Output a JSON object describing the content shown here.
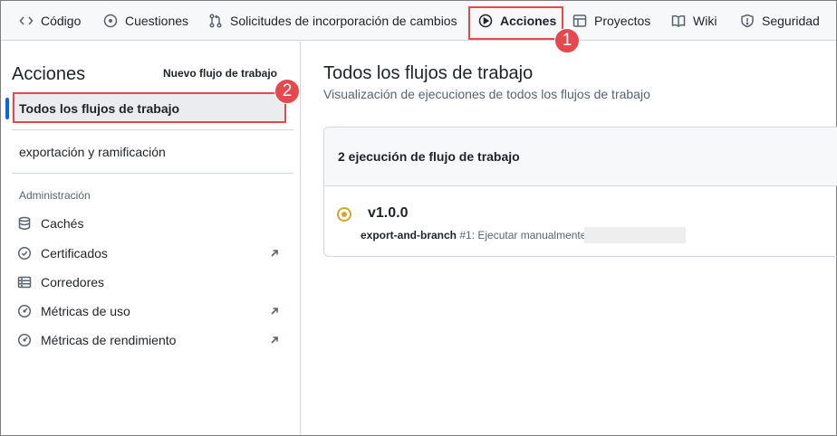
{
  "nav": {
    "tabs": [
      {
        "label": "Código",
        "icon": "code-icon"
      },
      {
        "label": "Cuestiones",
        "icon": "issue-icon"
      },
      {
        "label": "Solicitudes de incorporación de cambios",
        "icon": "pull-request-icon"
      },
      {
        "label": "Acciones",
        "icon": "play-icon",
        "active": true
      },
      {
        "label": "Proyectos",
        "icon": "table-icon"
      },
      {
        "label": "Wiki",
        "icon": "book-icon"
      },
      {
        "label": "Seguridad",
        "icon": "shield-icon"
      }
    ]
  },
  "annotations": {
    "badge1": "1",
    "badge2": "2",
    "color": "#e5484d"
  },
  "sidebar": {
    "title": "Acciones",
    "new_workflow": "Nuevo flujo de trabajo",
    "all_workflows": "Todos los flujos de trabajo",
    "workflow_item": "exportación y ramificación",
    "management_heading": "Administración",
    "management": [
      {
        "label": "Cachés",
        "icon": "database-icon",
        "external": false
      },
      {
        "label": "Certificados",
        "icon": "verified-icon",
        "external": true
      },
      {
        "label": "Corredores",
        "icon": "server-icon",
        "external": false
      },
      {
        "label": "Métricas de uso",
        "icon": "gauge-icon",
        "external": true
      },
      {
        "label": "Métricas de rendimiento",
        "icon": "gauge-icon",
        "external": true
      }
    ]
  },
  "main": {
    "title": "Todos los flujos de trabajo",
    "subtitle": "Visualización de ejecuciones de todos los flujos de trabajo",
    "runs_count": "2 ejecución de flujo de trabajo",
    "run": {
      "title": "v1.0.0",
      "workflow": "export-and-branch",
      "detail": " #1: Ejecutar manualmente",
      "status_color": "#d4a72c"
    }
  }
}
